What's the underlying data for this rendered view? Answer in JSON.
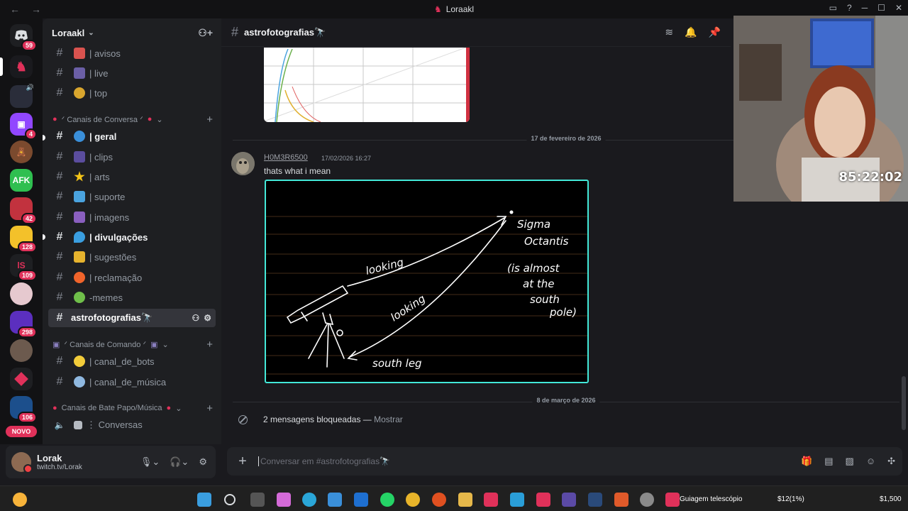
{
  "window": {
    "title": "Loraakl",
    "back": "←",
    "forward": "→"
  },
  "rail": {
    "servers": [
      {
        "name": "discord-home",
        "badge": "59"
      },
      {
        "name": "server-loraakl",
        "badge": ""
      },
      {
        "name": "server-dark",
        "badge": ""
      },
      {
        "name": "server-twitch",
        "badge": "4"
      },
      {
        "name": "server-bear",
        "badge": ""
      },
      {
        "name": "server-afk",
        "label": "AFK",
        "badge": ""
      },
      {
        "name": "server-red-face",
        "badge": "42"
      },
      {
        "name": "server-yellow",
        "badge": "128"
      },
      {
        "name": "server-red-logo",
        "badge": "109"
      },
      {
        "name": "server-pink",
        "badge": ""
      },
      {
        "name": "server-purple",
        "badge": "298"
      },
      {
        "name": "server-photo",
        "badge": ""
      },
      {
        "name": "server-red-diamond",
        "badge": ""
      },
      {
        "name": "server-blue",
        "badge": "106"
      }
    ],
    "novo": "NOVO"
  },
  "sidebar": {
    "guild_name": "Loraakl",
    "channels_top": [
      {
        "label": "| avisos"
      },
      {
        "label": "| live"
      },
      {
        "label": "| top"
      }
    ],
    "cat_conversa": "ᐟ Canais de Conversa ᐟ",
    "channels_conversa": [
      {
        "label": "| geral"
      },
      {
        "label": "| clips"
      },
      {
        "label": "| arts"
      },
      {
        "label": "| suporte"
      },
      {
        "label": "| imagens"
      },
      {
        "label": "| divulgações"
      },
      {
        "label": "| sugestões"
      },
      {
        "label": "| reclamação"
      },
      {
        "label": "-memes"
      },
      {
        "label": "astrofotografias🔭"
      }
    ],
    "cat_comando": "ᐟ Canais de Comando ᐟ",
    "channels_comando": [
      {
        "label": "| canal_de_bots"
      },
      {
        "label": "| canal_de_música"
      }
    ],
    "cat_bate_papo": "Canais de Bate Papo/Música",
    "voice": [
      {
        "label": "⋮ Conversas"
      }
    ]
  },
  "user": {
    "name": "Lorak",
    "status": "twitch.tv/Lorak"
  },
  "channel": {
    "name": "astrofotografias🔭"
  },
  "messages": {
    "date_1": "17 de fevereiro de 2026",
    "author": "H0M3R6500",
    "timestamp": "17/02/2026 16:27",
    "text": "thats what i mean",
    "date_2": "8 de março de 2026",
    "blocked": "2 mensagens bloqueadas —",
    "show": "Mostrar"
  },
  "drawing": {
    "target_line1": "Sigma",
    "target_line2": "Octantis",
    "note_line1": "(is almost",
    "note_line2": "at the",
    "note_line3": "south",
    "note_line4": "pole)",
    "looking_1": "looking",
    "looking_2": "looking",
    "south_leg": "south leg"
  },
  "composer": {
    "placeholder": "Conversar em #astrofotografias🔭"
  },
  "stream": {
    "timer": "85:22:02"
  },
  "taskbar": {
    "app_label": "Guiagem telescópio",
    "money_1": "$12(1%)",
    "money_2": "$1,500"
  }
}
